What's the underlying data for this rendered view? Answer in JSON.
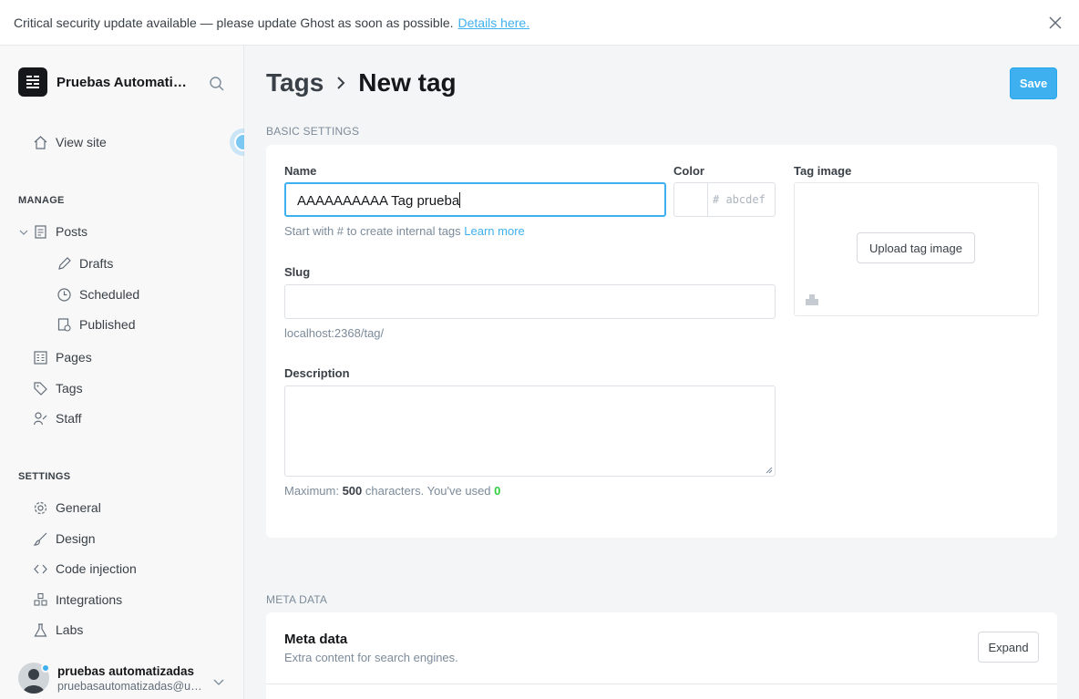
{
  "banner": {
    "message": "Critical security update available — please update Ghost as soon as possible.",
    "link": "Details here."
  },
  "sidebar": {
    "site_name": "Pruebas Automatizadas",
    "view_site": "View site",
    "manage_title": "MANAGE",
    "items": {
      "posts": "Posts",
      "drafts": "Drafts",
      "scheduled": "Scheduled",
      "published": "Published",
      "pages": "Pages",
      "tags": "Tags",
      "staff": "Staff"
    },
    "settings_title": "SETTINGS",
    "settings": {
      "general": "General",
      "design": "Design",
      "code_injection": "Code injection",
      "integrations": "Integrations",
      "labs": "Labs"
    },
    "user": {
      "name": "pruebas automatizadas",
      "email": "pruebasautomatizadas@uniandes.edu.co"
    }
  },
  "header": {
    "crumb": "Tags",
    "title": "New tag",
    "save_label": "Save"
  },
  "basic": {
    "section_label": "BASIC SETTINGS",
    "name_label": "Name",
    "name_value": "AAAAAAAAAA Tag prueba",
    "name_hint": "Start with # to create internal tags",
    "learn_more": "Learn more",
    "color_label": "Color",
    "color_placeholder": "# abcdef",
    "tag_image_label": "Tag image",
    "upload_label": "Upload tag image",
    "slug_label": "Slug",
    "slug_value": "",
    "slug_url": "localhost:2368/tag/",
    "description_label": "Description",
    "desc_max_prefix": "Maximum:",
    "desc_max": "500",
    "desc_mid": "characters. You've used",
    "desc_used": "0"
  },
  "meta": {
    "section_label": "META DATA",
    "title": "Meta data",
    "subtitle": "Extra content for search engines.",
    "expand_label": "Expand"
  },
  "colors": {
    "accent": "#3eb0ef",
    "used_count": "#30cf43"
  }
}
